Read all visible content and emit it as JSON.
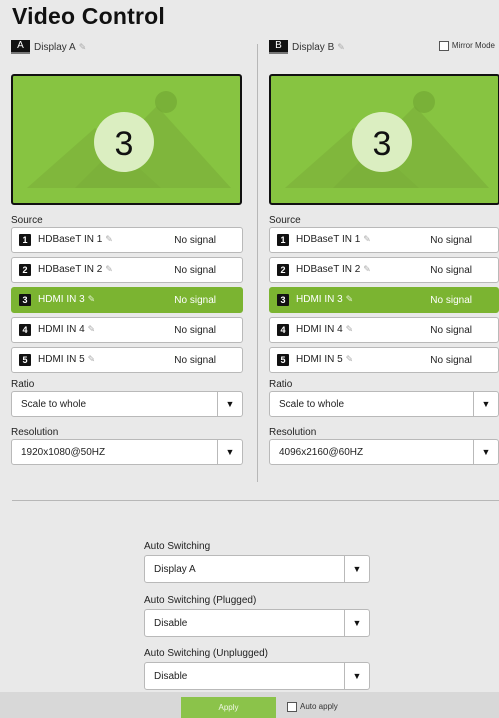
{
  "page_title": "Video Control",
  "displays": [
    {
      "letter": "A",
      "name": "Display A",
      "preview_number": "3",
      "source_label": "Source",
      "sources": [
        {
          "num": "1",
          "name": "HDBaseT IN 1",
          "status": "No signal",
          "active": false
        },
        {
          "num": "2",
          "name": "HDBaseT IN 2",
          "status": "No signal",
          "active": false
        },
        {
          "num": "3",
          "name": "HDMI IN 3",
          "status": "No signal",
          "active": true
        },
        {
          "num": "4",
          "name": "HDMI IN 4",
          "status": "No signal",
          "active": false
        },
        {
          "num": "5",
          "name": "HDMI IN 5",
          "status": "No signal",
          "active": false
        }
      ],
      "ratio_label": "Ratio",
      "ratio_value": "Scale to whole",
      "resolution_label": "Resolution",
      "resolution_value": "1920x1080@50HZ"
    },
    {
      "letter": "B",
      "name": "Display B",
      "mirror_label": "Mirror Mode",
      "mirror_checked": false,
      "preview_number": "3",
      "source_label": "Source",
      "sources": [
        {
          "num": "1",
          "name": "HDBaseT IN 1",
          "status": "No signal",
          "active": false
        },
        {
          "num": "2",
          "name": "HDBaseT IN 2",
          "status": "No signal",
          "active": false
        },
        {
          "num": "3",
          "name": "HDMI IN 3",
          "status": "No signal",
          "active": true
        },
        {
          "num": "4",
          "name": "HDMI IN 4",
          "status": "No signal",
          "active": false
        },
        {
          "num": "5",
          "name": "HDMI IN 5",
          "status": "No signal",
          "active": false
        }
      ],
      "ratio_label": "Ratio",
      "ratio_value": "Scale to whole",
      "resolution_label": "Resolution",
      "resolution_value": "4096x2160@60HZ"
    }
  ],
  "auto_switching": {
    "label": "Auto Switching",
    "value": "Display A",
    "plugged_label": "Auto Switching (Plugged)",
    "plugged_value": "Disable",
    "unplugged_label": "Auto Switching (Unplugged)",
    "unplugged_value": "Disable"
  },
  "footer": {
    "apply_label": "Apply",
    "auto_apply_label": "Auto apply",
    "auto_apply_checked": false
  },
  "colors": {
    "accent_green": "#7bb431",
    "preview_green": "#87c441",
    "background": "#e9e9e9"
  },
  "icons": {
    "edit": "pencil-icon",
    "dropdown": "caret-down-icon"
  }
}
